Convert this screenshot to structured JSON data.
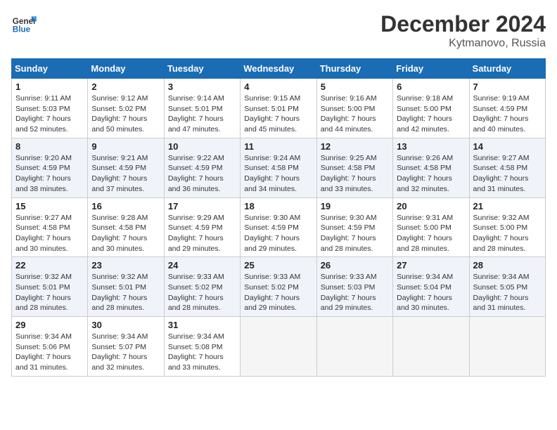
{
  "logo": {
    "line1": "General",
    "line2": "Blue"
  },
  "title": "December 2024",
  "location": "Kytmanovo, Russia",
  "days_of_week": [
    "Sunday",
    "Monday",
    "Tuesday",
    "Wednesday",
    "Thursday",
    "Friday",
    "Saturday"
  ],
  "weeks": [
    [
      {
        "day": "1",
        "sunrise": "Sunrise: 9:11 AM",
        "sunset": "Sunset: 5:03 PM",
        "daylight": "Daylight: 7 hours and 52 minutes."
      },
      {
        "day": "2",
        "sunrise": "Sunrise: 9:12 AM",
        "sunset": "Sunset: 5:02 PM",
        "daylight": "Daylight: 7 hours and 50 minutes."
      },
      {
        "day": "3",
        "sunrise": "Sunrise: 9:14 AM",
        "sunset": "Sunset: 5:01 PM",
        "daylight": "Daylight: 7 hours and 47 minutes."
      },
      {
        "day": "4",
        "sunrise": "Sunrise: 9:15 AM",
        "sunset": "Sunset: 5:01 PM",
        "daylight": "Daylight: 7 hours and 45 minutes."
      },
      {
        "day": "5",
        "sunrise": "Sunrise: 9:16 AM",
        "sunset": "Sunset: 5:00 PM",
        "daylight": "Daylight: 7 hours and 44 minutes."
      },
      {
        "day": "6",
        "sunrise": "Sunrise: 9:18 AM",
        "sunset": "Sunset: 5:00 PM",
        "daylight": "Daylight: 7 hours and 42 minutes."
      },
      {
        "day": "7",
        "sunrise": "Sunrise: 9:19 AM",
        "sunset": "Sunset: 4:59 PM",
        "daylight": "Daylight: 7 hours and 40 minutes."
      }
    ],
    [
      {
        "day": "8",
        "sunrise": "Sunrise: 9:20 AM",
        "sunset": "Sunset: 4:59 PM",
        "daylight": "Daylight: 7 hours and 38 minutes."
      },
      {
        "day": "9",
        "sunrise": "Sunrise: 9:21 AM",
        "sunset": "Sunset: 4:59 PM",
        "daylight": "Daylight: 7 hours and 37 minutes."
      },
      {
        "day": "10",
        "sunrise": "Sunrise: 9:22 AM",
        "sunset": "Sunset: 4:59 PM",
        "daylight": "Daylight: 7 hours and 36 minutes."
      },
      {
        "day": "11",
        "sunrise": "Sunrise: 9:24 AM",
        "sunset": "Sunset: 4:58 PM",
        "daylight": "Daylight: 7 hours and 34 minutes."
      },
      {
        "day": "12",
        "sunrise": "Sunrise: 9:25 AM",
        "sunset": "Sunset: 4:58 PM",
        "daylight": "Daylight: 7 hours and 33 minutes."
      },
      {
        "day": "13",
        "sunrise": "Sunrise: 9:26 AM",
        "sunset": "Sunset: 4:58 PM",
        "daylight": "Daylight: 7 hours and 32 minutes."
      },
      {
        "day": "14",
        "sunrise": "Sunrise: 9:27 AM",
        "sunset": "Sunset: 4:58 PM",
        "daylight": "Daylight: 7 hours and 31 minutes."
      }
    ],
    [
      {
        "day": "15",
        "sunrise": "Sunrise: 9:27 AM",
        "sunset": "Sunset: 4:58 PM",
        "daylight": "Daylight: 7 hours and 30 minutes."
      },
      {
        "day": "16",
        "sunrise": "Sunrise: 9:28 AM",
        "sunset": "Sunset: 4:58 PM",
        "daylight": "Daylight: 7 hours and 30 minutes."
      },
      {
        "day": "17",
        "sunrise": "Sunrise: 9:29 AM",
        "sunset": "Sunset: 4:59 PM",
        "daylight": "Daylight: 7 hours and 29 minutes."
      },
      {
        "day": "18",
        "sunrise": "Sunrise: 9:30 AM",
        "sunset": "Sunset: 4:59 PM",
        "daylight": "Daylight: 7 hours and 29 minutes."
      },
      {
        "day": "19",
        "sunrise": "Sunrise: 9:30 AM",
        "sunset": "Sunset: 4:59 PM",
        "daylight": "Daylight: 7 hours and 28 minutes."
      },
      {
        "day": "20",
        "sunrise": "Sunrise: 9:31 AM",
        "sunset": "Sunset: 5:00 PM",
        "daylight": "Daylight: 7 hours and 28 minutes."
      },
      {
        "day": "21",
        "sunrise": "Sunrise: 9:32 AM",
        "sunset": "Sunset: 5:00 PM",
        "daylight": "Daylight: 7 hours and 28 minutes."
      }
    ],
    [
      {
        "day": "22",
        "sunrise": "Sunrise: 9:32 AM",
        "sunset": "Sunset: 5:01 PM",
        "daylight": "Daylight: 7 hours and 28 minutes."
      },
      {
        "day": "23",
        "sunrise": "Sunrise: 9:32 AM",
        "sunset": "Sunset: 5:01 PM",
        "daylight": "Daylight: 7 hours and 28 minutes."
      },
      {
        "day": "24",
        "sunrise": "Sunrise: 9:33 AM",
        "sunset": "Sunset: 5:02 PM",
        "daylight": "Daylight: 7 hours and 28 minutes."
      },
      {
        "day": "25",
        "sunrise": "Sunrise: 9:33 AM",
        "sunset": "Sunset: 5:02 PM",
        "daylight": "Daylight: 7 hours and 29 minutes."
      },
      {
        "day": "26",
        "sunrise": "Sunrise: 9:33 AM",
        "sunset": "Sunset: 5:03 PM",
        "daylight": "Daylight: 7 hours and 29 minutes."
      },
      {
        "day": "27",
        "sunrise": "Sunrise: 9:34 AM",
        "sunset": "Sunset: 5:04 PM",
        "daylight": "Daylight: 7 hours and 30 minutes."
      },
      {
        "day": "28",
        "sunrise": "Sunrise: 9:34 AM",
        "sunset": "Sunset: 5:05 PM",
        "daylight": "Daylight: 7 hours and 31 minutes."
      }
    ],
    [
      {
        "day": "29",
        "sunrise": "Sunrise: 9:34 AM",
        "sunset": "Sunset: 5:06 PM",
        "daylight": "Daylight: 7 hours and 31 minutes."
      },
      {
        "day": "30",
        "sunrise": "Sunrise: 9:34 AM",
        "sunset": "Sunset: 5:07 PM",
        "daylight": "Daylight: 7 hours and 32 minutes."
      },
      {
        "day": "31",
        "sunrise": "Sunrise: 9:34 AM",
        "sunset": "Sunset: 5:08 PM",
        "daylight": "Daylight: 7 hours and 33 minutes."
      },
      null,
      null,
      null,
      null
    ]
  ]
}
